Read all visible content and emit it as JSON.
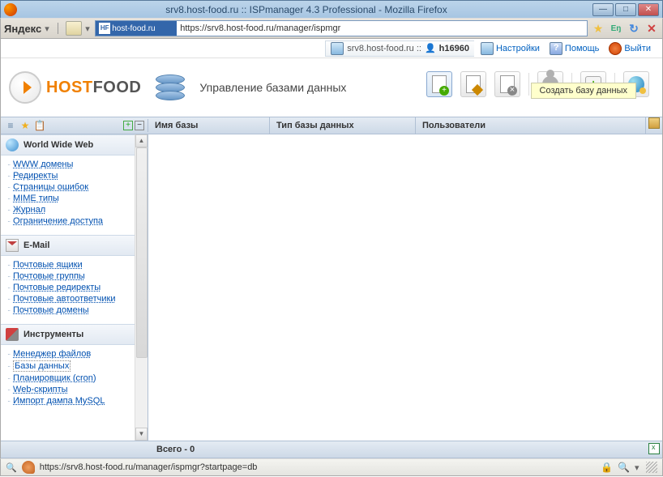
{
  "window": {
    "title": "srv8.host-food.ru :: ISPmanager 4.3 Professional - Mozilla Firefox"
  },
  "browser": {
    "yandex_label": "Яндекс",
    "favicon_text": "host-food.ru",
    "favicon_prefix": "HF",
    "url": "https://srv8.host-food.ru/manager/ispmgr",
    "status_url": "https://srv8.host-food.ru/manager/ispmgr?startpage=db"
  },
  "info": {
    "host": "srv8.host-food.ru ::",
    "user": "h16960",
    "settings": "Настройки",
    "help": "Помощь",
    "exit": "Выйти"
  },
  "logo": {
    "t1": "HOST",
    "t2": "FOOD"
  },
  "page": {
    "title": "Управление базами данных"
  },
  "tooltip": {
    "create_db": "Создать базу данных"
  },
  "columns": {
    "c1": "Имя базы",
    "c2": "Тип базы данных",
    "c3": "Пользователи"
  },
  "sidebar": {
    "groups": [
      {
        "id": "www",
        "title": "World Wide Web",
        "icon": "www",
        "items": [
          "WWW домены",
          "Редиректы",
          "Страницы ошибок",
          "MIME типы",
          "Журнал",
          "Ограничение доступа"
        ]
      },
      {
        "id": "email",
        "title": "E-Mail",
        "icon": "mail",
        "items": [
          "Почтовые ящики",
          "Почтовые группы",
          "Почтовые редиректы",
          "Почтовые автоответчики",
          "Почтовые домены"
        ]
      },
      {
        "id": "tools",
        "title": "Инструменты",
        "icon": "tools",
        "items": [
          "Менеджер файлов",
          "Базы данных",
          "Планировщик (cron)",
          "Web-скрипты",
          "Импорт дампа MySQL"
        ],
        "selected_index": 1
      }
    ]
  },
  "footer": {
    "total": "Всего - 0"
  }
}
